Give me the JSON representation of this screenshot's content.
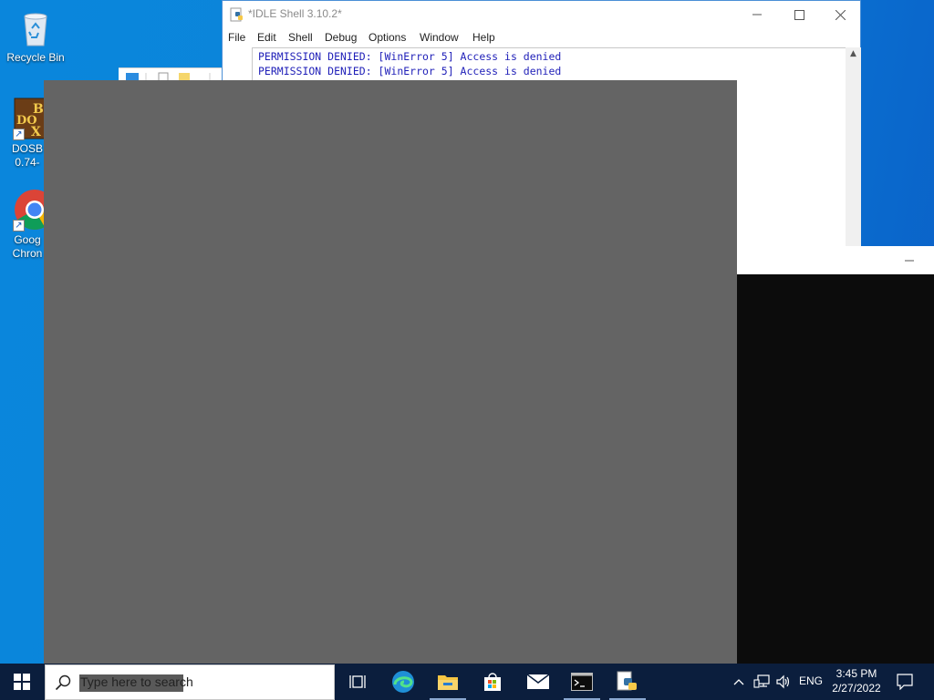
{
  "desktop": {
    "icons": [
      {
        "label": "Recycle Bin",
        "icon": "recycle-bin-icon"
      },
      {
        "label_lines": [
          "DOSB",
          "0.74-"
        ],
        "icon": "dosbox-icon"
      },
      {
        "label_lines": [
          "Goog",
          "Chron"
        ],
        "icon": "chrome-icon"
      }
    ]
  },
  "idle_window": {
    "title": "*IDLE Shell 3.10.2*",
    "menu": [
      "File",
      "Edit",
      "Shell",
      "Debug",
      "Options",
      "Window",
      "Help"
    ],
    "output_lines": [
      "PERMISSION DENIED: [WinError 5] Access is denied",
      "PERMISSION DENIED: [WinError 5] Access is denied"
    ]
  },
  "taskbar": {
    "search_placeholder": "Type here to search",
    "pinned": [
      "task-view-icon",
      "edge-icon",
      "file-explorer-icon",
      "store-icon",
      "mail-icon",
      "terminal-icon",
      "python-idle-icon"
    ],
    "tray": {
      "language": "ENG",
      "time": "3:45 PM",
      "date": "2/27/2022"
    }
  },
  "colors": {
    "desktop_blue": "#0a7fd6",
    "taskbar": "#0b1e3d",
    "idle_output_text": "#1f1fb8",
    "overlay_gray": "#646464"
  }
}
